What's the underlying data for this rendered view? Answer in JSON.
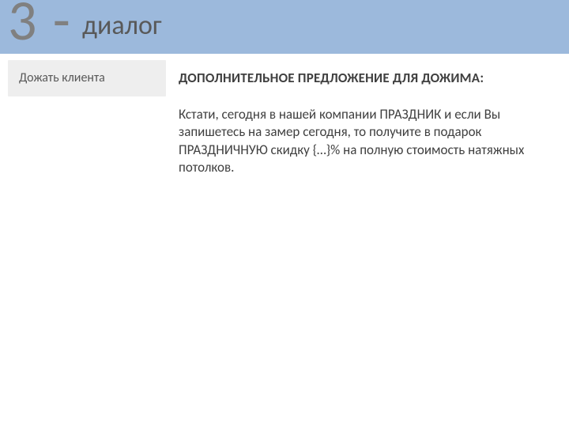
{
  "header": {
    "number": "3",
    "dash": "-",
    "title": "диалог"
  },
  "side": {
    "label": "Дожать клиента"
  },
  "content": {
    "heading": "ДОПОЛНИТЕЛЬНОЕ ПРЕДЛОЖЕНИЕ ДЛЯ ДОЖИМА:",
    "body": "Кстати, сегодня в нашей компании ПРАЗДНИК и если Вы запишетесь на замер сегодня, то получите в подарок ПРАЗДНИЧНУЮ скидку {…}% на полную стоимость натяжных потолков."
  }
}
